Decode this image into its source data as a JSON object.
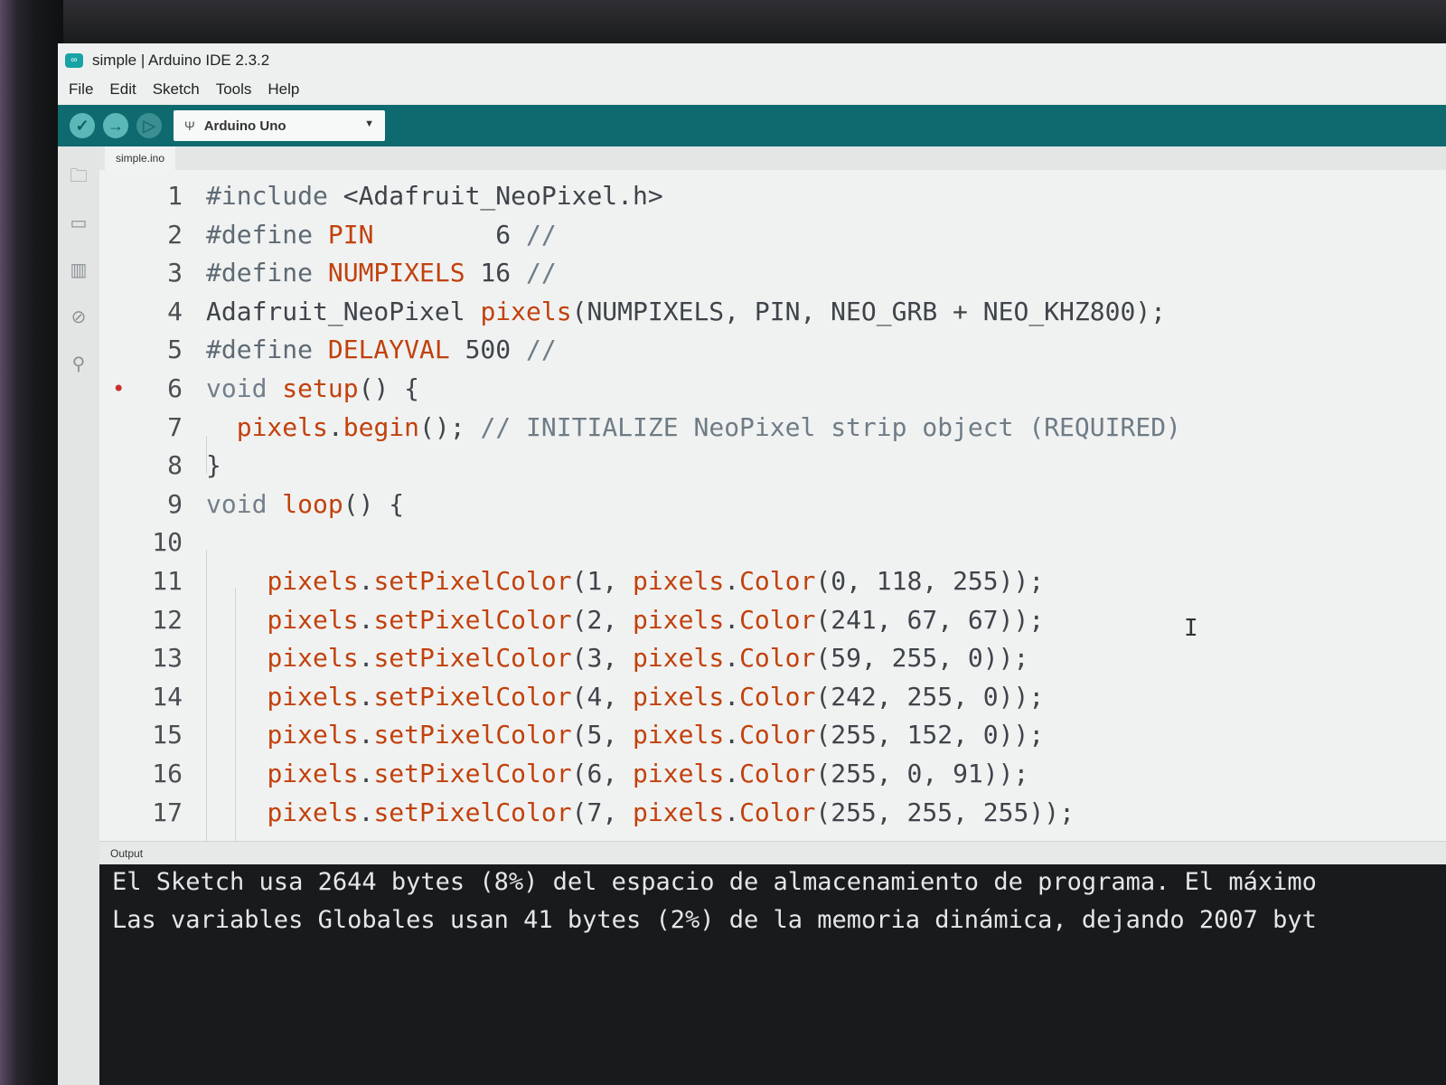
{
  "window": {
    "title": "simple | Arduino IDE 2.3.2"
  },
  "menu": [
    "File",
    "Edit",
    "Sketch",
    "Tools",
    "Help"
  ],
  "toolbar": {
    "verify_icon": "check-icon",
    "upload_icon": "arrow-right-icon",
    "debug_icon": "debug-icon",
    "board": "Arduino Uno"
  },
  "tabs": [
    "simple.ino"
  ],
  "editor": {
    "lines": [
      {
        "n": "1",
        "segs": [
          [
            "mac",
            "#include "
          ],
          [
            "txt",
            "<Adafruit_NeoPixel.h>"
          ]
        ]
      },
      {
        "n": "2",
        "segs": [
          [
            "mac",
            "#define "
          ],
          [
            "fn",
            "PIN"
          ],
          [
            "txt",
            "        6 "
          ],
          [
            "cm",
            "//"
          ]
        ]
      },
      {
        "n": "3",
        "segs": [
          [
            "mac",
            "#define "
          ],
          [
            "fn",
            "NUMPIXELS"
          ],
          [
            "txt",
            " 16 "
          ],
          [
            "cm",
            "//"
          ]
        ]
      },
      {
        "n": "4",
        "segs": [
          [
            "txt",
            "Adafruit_NeoPixel "
          ],
          [
            "fn",
            "pixels"
          ],
          [
            "txt",
            "(NUMPIXELS, PIN, NEO_GRB + NEO_KHZ800);"
          ]
        ]
      },
      {
        "n": "5",
        "segs": [
          [
            "mac",
            "#define "
          ],
          [
            "fn",
            "DELAYVAL"
          ],
          [
            "txt",
            " 500 "
          ],
          [
            "cm",
            "//"
          ]
        ]
      },
      {
        "n": "6",
        "bp": true,
        "segs": [
          [
            "kw",
            "void "
          ],
          [
            "fn",
            "setup"
          ],
          [
            "txt",
            "() {"
          ]
        ]
      },
      {
        "n": "7",
        "segs": [
          [
            "txt",
            "  "
          ],
          [
            "fn",
            "pixels"
          ],
          [
            "txt",
            "."
          ],
          [
            "fn",
            "begin"
          ],
          [
            "txt",
            "(); "
          ],
          [
            "cm",
            "// INITIALIZE NeoPixel strip object (REQUIRED)"
          ]
        ]
      },
      {
        "n": "8",
        "segs": [
          [
            "txt",
            "}"
          ]
        ]
      },
      {
        "n": "9",
        "segs": [
          [
            "kw",
            "void "
          ],
          [
            "fn",
            "loop"
          ],
          [
            "txt",
            "() {"
          ]
        ]
      },
      {
        "n": "10",
        "segs": []
      },
      {
        "n": "11",
        "segs": [
          [
            "txt",
            "    "
          ],
          [
            "fn",
            "pixels"
          ],
          [
            "txt",
            "."
          ],
          [
            "fn",
            "setPixelColor"
          ],
          [
            "txt",
            "(1, "
          ],
          [
            "fn",
            "pixels"
          ],
          [
            "txt",
            "."
          ],
          [
            "fn",
            "Color"
          ],
          [
            "txt",
            "(0, 118, 255));"
          ]
        ]
      },
      {
        "n": "12",
        "segs": [
          [
            "txt",
            "    "
          ],
          [
            "fn",
            "pixels"
          ],
          [
            "txt",
            "."
          ],
          [
            "fn",
            "setPixelColor"
          ],
          [
            "txt",
            "(2, "
          ],
          [
            "fn",
            "pixels"
          ],
          [
            "txt",
            "."
          ],
          [
            "fn",
            "Color"
          ],
          [
            "txt",
            "(241, 67, 67));"
          ]
        ]
      },
      {
        "n": "13",
        "segs": [
          [
            "txt",
            "    "
          ],
          [
            "fn",
            "pixels"
          ],
          [
            "txt",
            "."
          ],
          [
            "fn",
            "setPixelColor"
          ],
          [
            "txt",
            "(3, "
          ],
          [
            "fn",
            "pixels"
          ],
          [
            "txt",
            "."
          ],
          [
            "fn",
            "Color"
          ],
          [
            "txt",
            "(59, 255, 0));"
          ]
        ]
      },
      {
        "n": "14",
        "segs": [
          [
            "txt",
            "    "
          ],
          [
            "fn",
            "pixels"
          ],
          [
            "txt",
            "."
          ],
          [
            "fn",
            "setPixelColor"
          ],
          [
            "txt",
            "(4, "
          ],
          [
            "fn",
            "pixels"
          ],
          [
            "txt",
            "."
          ],
          [
            "fn",
            "Color"
          ],
          [
            "txt",
            "(242, 255, 0));"
          ]
        ]
      },
      {
        "n": "15",
        "segs": [
          [
            "txt",
            "    "
          ],
          [
            "fn",
            "pixels"
          ],
          [
            "txt",
            "."
          ],
          [
            "fn",
            "setPixelColor"
          ],
          [
            "txt",
            "(5, "
          ],
          [
            "fn",
            "pixels"
          ],
          [
            "txt",
            "."
          ],
          [
            "fn",
            "Color"
          ],
          [
            "txt",
            "(255, 152, 0));"
          ]
        ]
      },
      {
        "n": "16",
        "segs": [
          [
            "txt",
            "    "
          ],
          [
            "fn",
            "pixels"
          ],
          [
            "txt",
            "."
          ],
          [
            "fn",
            "setPixelColor"
          ],
          [
            "txt",
            "(6, "
          ],
          [
            "fn",
            "pixels"
          ],
          [
            "txt",
            "."
          ],
          [
            "fn",
            "Color"
          ],
          [
            "txt",
            "(255, 0, 91));"
          ]
        ]
      },
      {
        "n": "17",
        "segs": [
          [
            "txt",
            "    "
          ],
          [
            "fn",
            "pixels"
          ],
          [
            "txt",
            "."
          ],
          [
            "fn",
            "setPixelColor"
          ],
          [
            "txt",
            "(7, "
          ],
          [
            "fn",
            "pixels"
          ],
          [
            "txt",
            "."
          ],
          [
            "fn",
            "Color"
          ],
          [
            "txt",
            "(255, 255, 255));"
          ]
        ]
      }
    ]
  },
  "output": {
    "tab": "Output",
    "lines": [
      "El Sketch usa 2644 bytes (8%) del espacio de almacenamiento de programa. El máximo",
      "Las variables Globales usan 41 bytes (2%) de la memoria dinámica, dejando 2007 byt"
    ]
  },
  "colors": {
    "toolbar": "#0f6a70",
    "accent": "#17a3a5",
    "function": "#c2410c",
    "breakpoint": "#c9302c"
  }
}
